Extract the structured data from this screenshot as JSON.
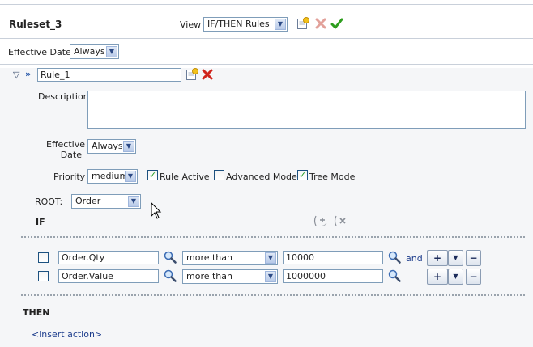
{
  "ruleset": {
    "title": "Ruleset_3",
    "view_label": "View",
    "view_value": "IF/THEN Rules",
    "effective_date_label": "Effective Date",
    "effective_date_value": "Always"
  },
  "rule": {
    "name": "Rule_1",
    "description_label": "Description",
    "description_value": "",
    "effective_date_label_line1": "Effective",
    "effective_date_label_line2": "Date",
    "effective_date_value": "Always",
    "priority_label": "Priority",
    "priority_value": "medium",
    "rule_active_label": "Rule Active",
    "rule_active_checked": true,
    "advanced_mode_label": "Advanced Mode",
    "advanced_mode_checked": false,
    "tree_mode_label": "Tree Mode",
    "tree_mode_checked": true,
    "root_label": "ROOT:",
    "root_value": "Order"
  },
  "if_section": {
    "label": "IF",
    "conditions": [
      {
        "field": "Order.Qty",
        "operator": "more than",
        "value": "10000",
        "connector": "and"
      },
      {
        "field": "Order.Value",
        "operator": "more than",
        "value": "1000000",
        "connector": ""
      }
    ]
  },
  "then_section": {
    "label": "THEN",
    "insert_action": "<insert action>"
  },
  "icons": {
    "add": "add-icon",
    "delete": "delete-icon",
    "validate": "checkmark-icon",
    "search": "magnifier-icon",
    "add_condition": "add-condition-icon",
    "remove_condition": "remove-condition-icon"
  },
  "colors": {
    "delete_red": "#d0241c",
    "validate_green": "#2e9e1e",
    "link_blue": "#1c3c8c"
  }
}
